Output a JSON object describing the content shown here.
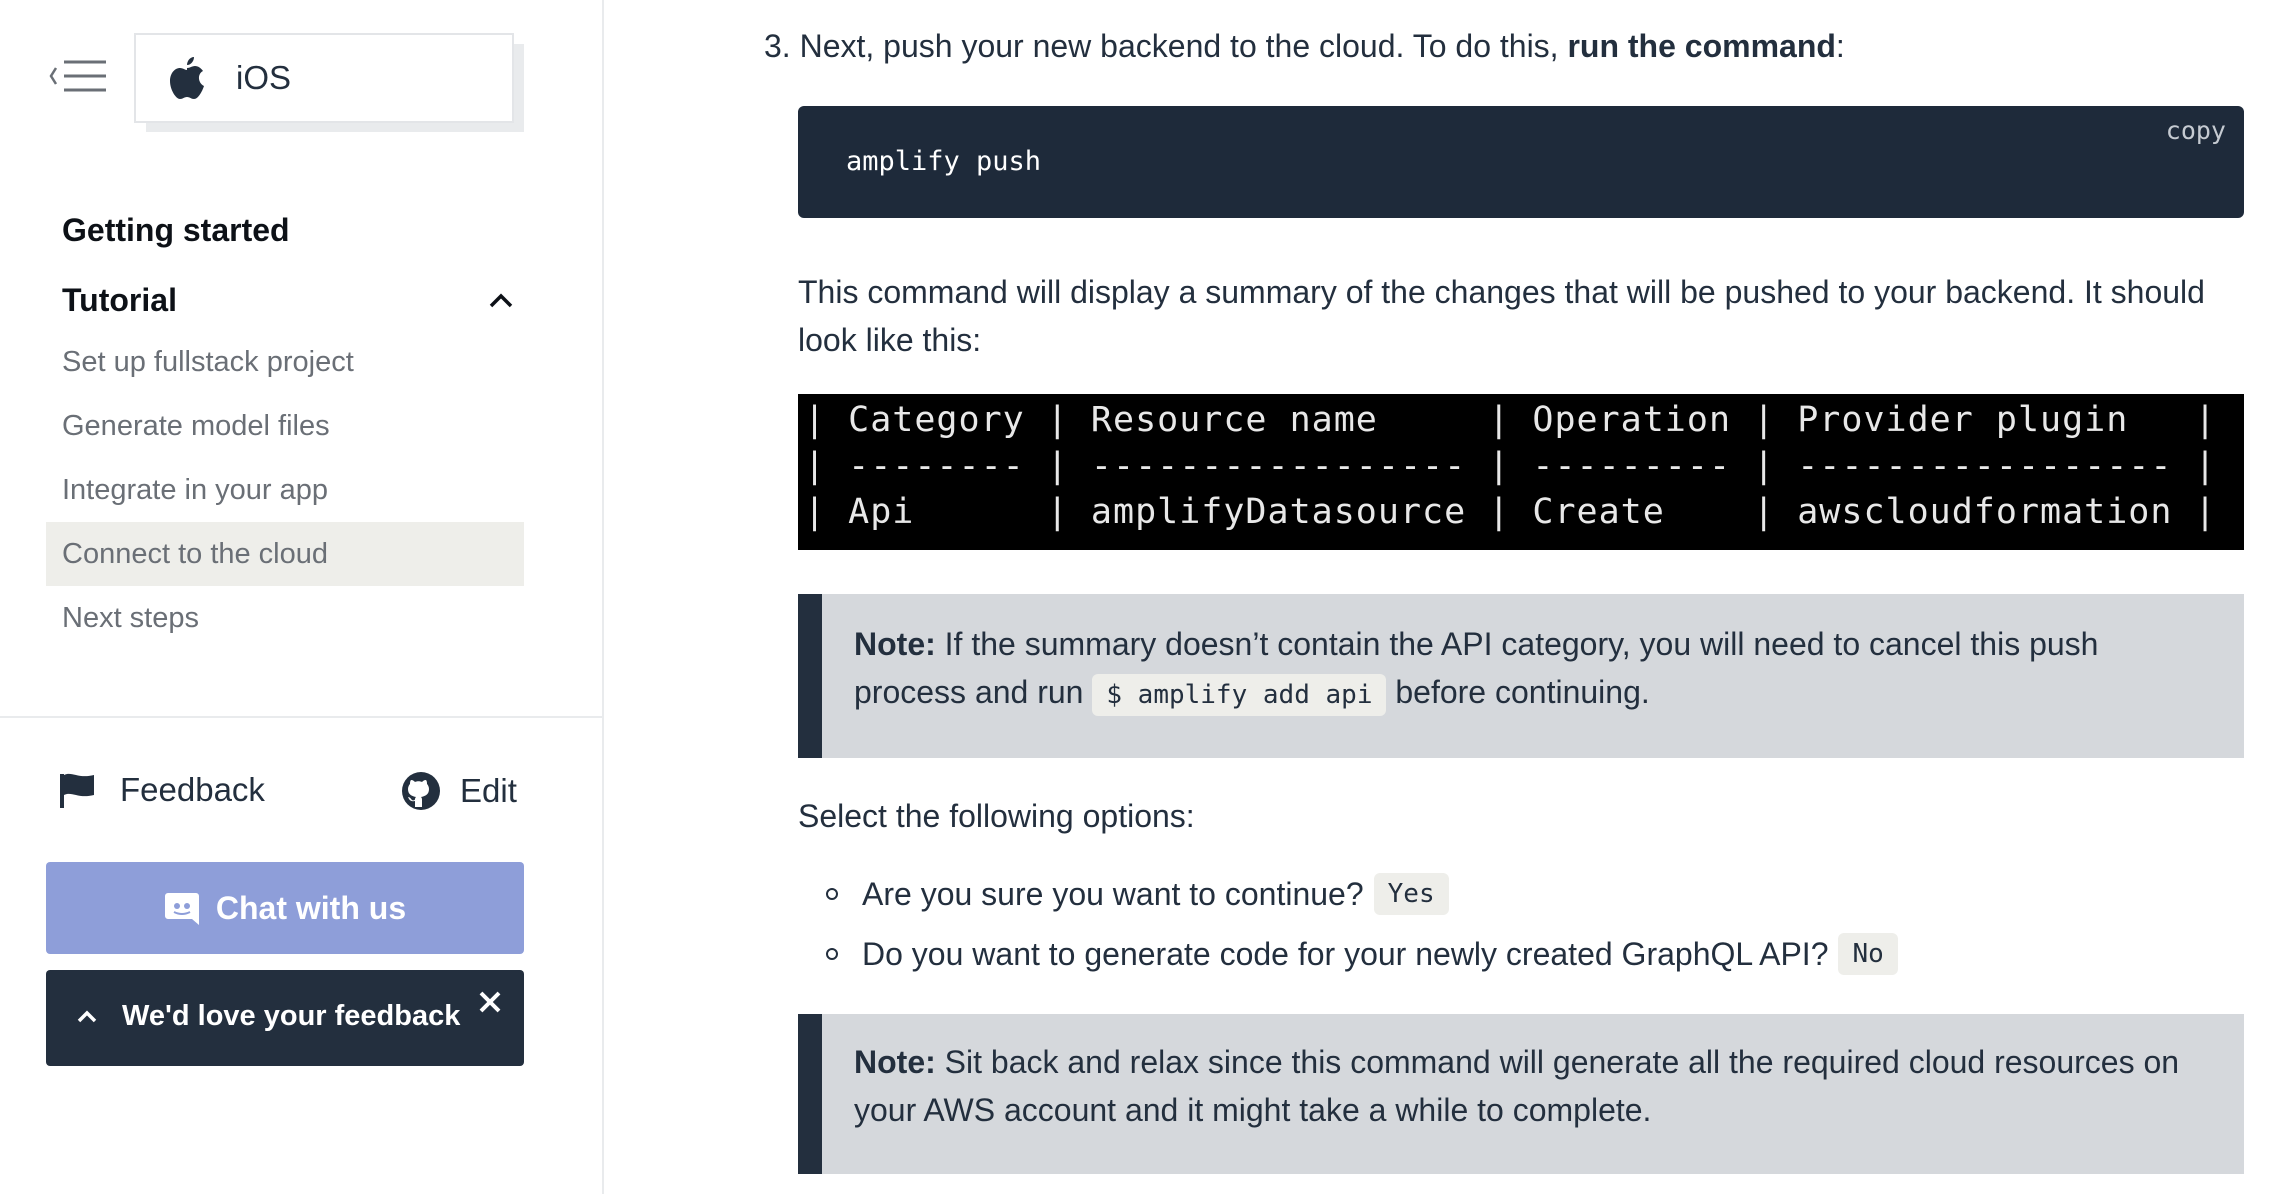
{
  "sidebar": {
    "platform": "iOS",
    "getting_started": "Getting started",
    "tutorial": "Tutorial",
    "items": [
      {
        "label": "Set up fullstack project"
      },
      {
        "label": "Generate model files"
      },
      {
        "label": "Integrate in your app"
      },
      {
        "label": "Connect to the cloud"
      },
      {
        "label": "Next steps"
      }
    ],
    "active_index": 3,
    "feedback": "Feedback",
    "edit": "Edit",
    "chat": "Chat with us",
    "feedback_banner": "We'd love your feedback"
  },
  "main": {
    "step_number": "3.",
    "step_text": "Next, push your new backend to the cloud. To do this, ",
    "step_bold": "run the command",
    "step_end": ":",
    "code": "amplify push",
    "copy_label": "copy",
    "summary_text": "This command will display a summary of the changes that will be pushed to your backend. It should look like this:",
    "terminal_lines": [
      "| Category | Resource name     | Operation | Provider plugin   |",
      "| -------- | ----------------- | --------- | ----------------- |",
      "| Api      | amplifyDatasource | Create    | awscloudformation |"
    ],
    "note1_label": "Note:",
    "note1_text_a": " If the summary doesn’t contain the API category, you will need to cancel this push process and run ",
    "note1_code": "$ amplify add api",
    "note1_text_b": " before continuing.",
    "select_text": "Select the following options:",
    "options": [
      {
        "text": "Are you sure you want to continue?",
        "code": "Yes"
      },
      {
        "text": "Do you want to generate code for your newly created GraphQL API?",
        "code": "No"
      }
    ],
    "note2_label": "Note:",
    "note2_text": " Sit back and relax since this command will generate all the required cloud resources on your AWS account and it might take a while to complete."
  },
  "colors": {
    "navy": "#232f3e",
    "chat_button": "#8e9ed9",
    "note_background": "#d5d8dc",
    "active_nav": "#eeeeea"
  },
  "icons": [
    "menu-collapse-icon",
    "apple-icon",
    "chevron-up-icon",
    "flag-icon",
    "github-icon",
    "discord-icon",
    "caret-up-icon",
    "close-icon"
  ]
}
